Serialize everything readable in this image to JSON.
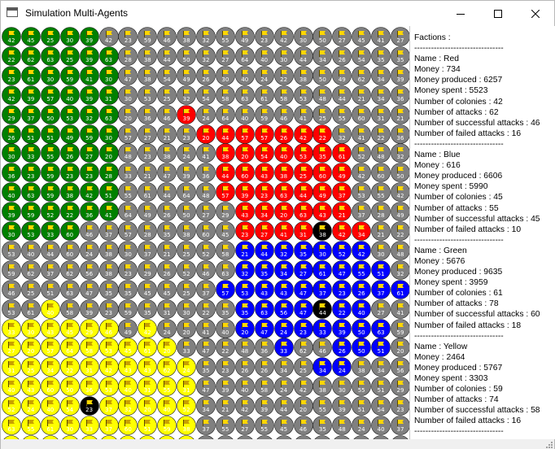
{
  "window": {
    "title": "Simulation Multi-Agents"
  },
  "colors": {
    "red": "#ff0000",
    "blue": "#0000ff",
    "green": "#008000",
    "yellow": "#ffff00",
    "neutral": "#808080",
    "black": "#000000",
    "flag": "#ffd700"
  },
  "legend": {
    "R": "Red",
    "B": "Blue",
    "G": "Green",
    "Y": "Yellow",
    "N": "neutral",
    "K": "black"
  },
  "grid": {
    "rows": [
      "GGGGGNNNNNNNNNNNNNNNN",
      "GGGGGGNNNNNNNNNNNNNNN",
      "GGGGGGNNNNNNNNNNNNNNN",
      "GGGGGGNNNNNNNNNNNNNNN",
      "GGGGGGNNNRNNNNNNNNNNN",
      "GGGGGGNNNNRRRRRRRNNNN",
      "GGGGGGNNNNNRRRRRRRNNN",
      "GGGGGGNNNNNRRRRRRRNNN",
      "GGGGGGNNNNNRRRRRRRNNN",
      "GGGGGGNNNNNNRRRRRRNNN",
      "GGGGNNNNNNNNRRRRKRRNN",
      "NNNNNNNNNNNNBBBBBBBNN",
      "NNNNNNNNNNNNBBBBBBBBN",
      "NNNNNNNNNNNBBBBBBBBBB",
      "NNYNNNNNNNNNBBBBKBBNN",
      "YYYYYYNYNNNNBBBBBBBBN",
      "YYYYYYYYYNNNNNBNNBBBN",
      "YYYYYYYYYYNNNNNNBBNNN",
      "YYYYYYYYYYNNNNNNNNNNN",
      "YYYYKYYYYYNNNNNNNNNNN",
      "YYYYYYYYYYNNNNNNNNNNN",
      "YYYYYYYYYYNNNNNNNNNNN"
    ]
  },
  "factions_panel": {
    "title": "Factions :",
    "separator": "--------------------------------",
    "factions": [
      {
        "name": "Name : Red",
        "money": "Money : 734",
        "produced": "Money produced : 6257",
        "spent": "Money spent : 5523",
        "colonies": "Number of colonies : 42",
        "attacks": "Number of attacks : 62",
        "success": "Number of successful attacks : 46",
        "failed": "Number of failed attacks : 16"
      },
      {
        "name": "Name : Blue",
        "money": "Money : 616",
        "produced": "Money produced : 6606",
        "spent": "Money spent : 5990",
        "colonies": "Number of colonies : 45",
        "attacks": "Number of attacks : 55",
        "success": "Number of successful attacks : 45",
        "failed": "Number of failed attacks : 10"
      },
      {
        "name": "Name : Green",
        "money": "Money : 5676",
        "produced": "Money produced : 9635",
        "spent": "Money spent : 3959",
        "colonies": "Number of colonies : 61",
        "attacks": "Number of attacks : 78",
        "success": "Number of successful attacks : 60",
        "failed": "Number of failed attacks : 18"
      },
      {
        "name": "Name : Yellow",
        "money": "Money : 2464",
        "produced": "Money produced : 5767",
        "spent": "Money spent : 3303",
        "colonies": "Number of colonies : 59",
        "attacks": "Number of attacks : 74",
        "success": "Number of successful attacks : 58",
        "failed": "Number of failed attacks : 16"
      }
    ]
  }
}
